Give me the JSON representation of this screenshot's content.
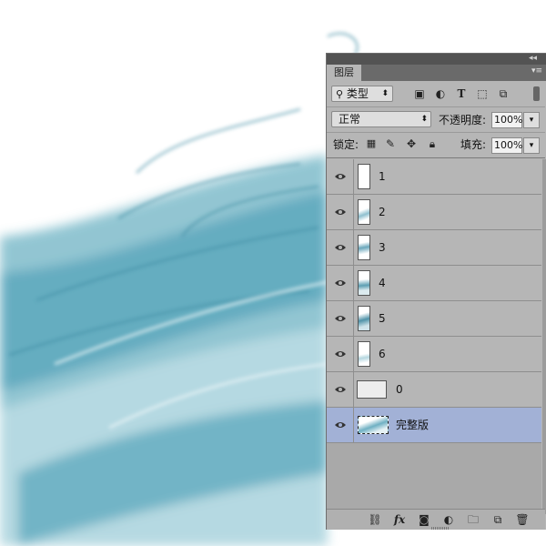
{
  "panel": {
    "tab_label": "图层",
    "filter_kind": "类型",
    "filter_icons": [
      "image-icon",
      "adjustment-icon",
      "type-icon",
      "shape-icon",
      "smart-object-icon"
    ],
    "blend_mode": "正常",
    "opacity_label": "不透明度:",
    "opacity_value": "100%",
    "lock_label": "锁定:",
    "lock_icons": [
      "lock-transparent-icon",
      "lock-paint-icon",
      "lock-position-icon",
      "lock-all-icon"
    ],
    "fill_label": "填充:",
    "fill_value": "100%",
    "layers": [
      {
        "name": "1",
        "visible": true,
        "selected": false
      },
      {
        "name": "2",
        "visible": true,
        "selected": false
      },
      {
        "name": "3",
        "visible": true,
        "selected": false
      },
      {
        "name": "4",
        "visible": true,
        "selected": false
      },
      {
        "name": "5",
        "visible": true,
        "selected": false
      },
      {
        "name": "6",
        "visible": true,
        "selected": false
      },
      {
        "name": "0",
        "visible": true,
        "selected": false
      },
      {
        "name": "完整版",
        "visible": true,
        "selected": true
      }
    ],
    "bottom_icons": [
      "link-layers-icon",
      "fx-icon",
      "add-mask-icon",
      "adjustment-layer-icon",
      "new-group-icon",
      "new-layer-icon",
      "delete-icon"
    ],
    "selected_color": "#a2b1d6",
    "panel_color": "#b6b6b6"
  }
}
